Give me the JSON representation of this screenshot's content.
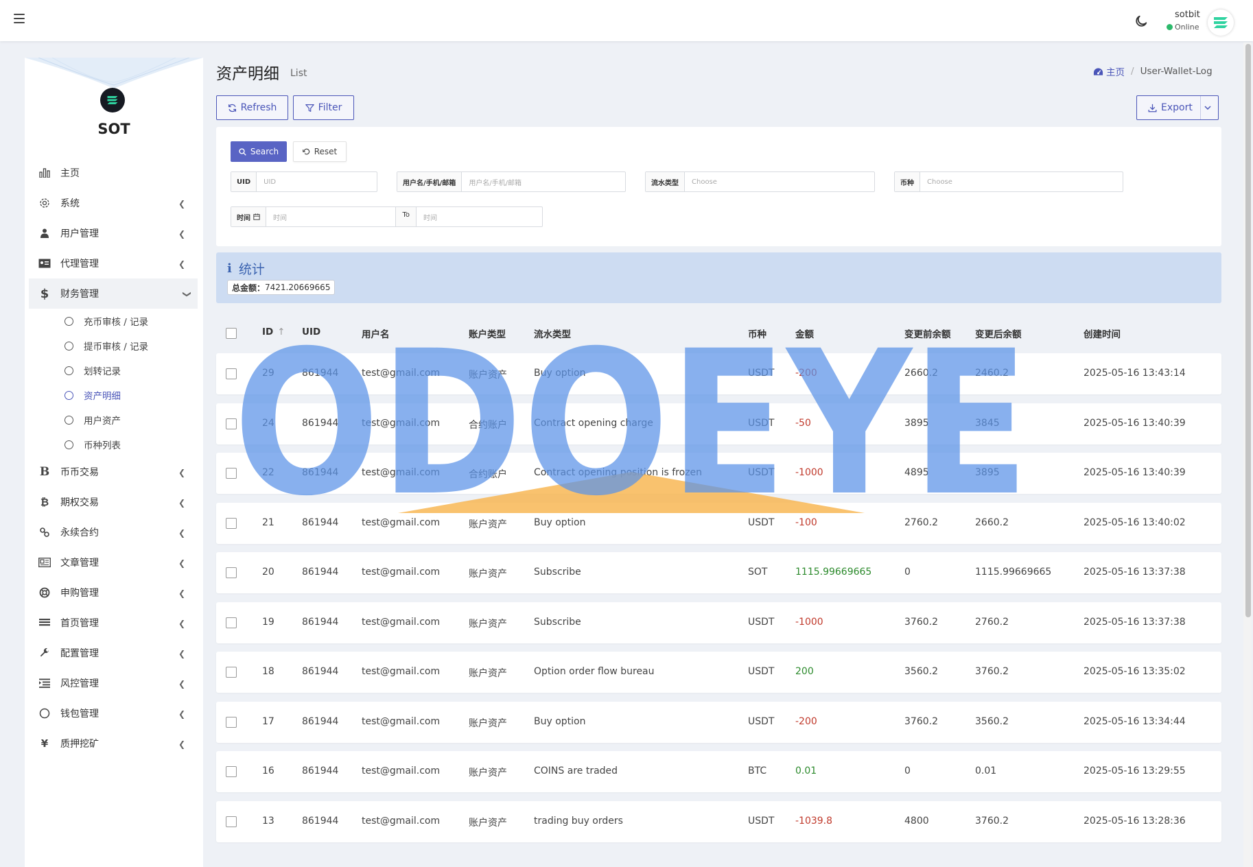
{
  "header": {
    "user_name": "sotbit",
    "user_status": "Online"
  },
  "sidebar": {
    "brand": "SOT",
    "items": [
      {
        "label": "主页",
        "icon": "bar-chart-icon",
        "has_children": false
      },
      {
        "label": "系统",
        "icon": "gear-icon",
        "has_children": true
      },
      {
        "label": "用户管理",
        "icon": "users-icon",
        "has_children": true
      },
      {
        "label": "代理管理",
        "icon": "id-card-icon",
        "has_children": true
      },
      {
        "label": "财务管理",
        "icon": "dollar-icon",
        "has_children": true,
        "open": true,
        "children": [
          {
            "label": "充币审核 / 记录"
          },
          {
            "label": "提币审核 / 记录"
          },
          {
            "label": "划转记录"
          },
          {
            "label": "资产明细",
            "active": true
          },
          {
            "label": "用户资产"
          },
          {
            "label": "币种列表"
          }
        ]
      },
      {
        "label": "币币交易",
        "icon": "b-icon",
        "has_children": true
      },
      {
        "label": "期权交易",
        "icon": "bitcoin-icon",
        "has_children": true
      },
      {
        "label": "永续合约",
        "icon": "link-icon",
        "has_children": true
      },
      {
        "label": "文章管理",
        "icon": "newspaper-icon",
        "has_children": true
      },
      {
        "label": "申购管理",
        "icon": "lifebuoy-icon",
        "has_children": true
      },
      {
        "label": "首页管理",
        "icon": "list-icon",
        "has_children": true
      },
      {
        "label": "配置管理",
        "icon": "wrench-icon",
        "has_children": true
      },
      {
        "label": "风控管理",
        "icon": "indent-icon",
        "has_children": true
      },
      {
        "label": "钱包管理",
        "icon": "circle-icon",
        "has_children": true
      },
      {
        "label": "质押挖矿",
        "icon": "yen-icon",
        "has_children": true
      }
    ]
  },
  "page": {
    "title": "资产明细",
    "subtitle": "List",
    "breadcrumb_home": "主页",
    "breadcrumb_current": "User-Wallet-Log"
  },
  "toolbar": {
    "refresh": "Refresh",
    "filter": "Filter",
    "export": "Export"
  },
  "filter": {
    "search": "Search",
    "reset": "Reset",
    "uid_label": "UID",
    "uid_placeholder": "UID",
    "user_label": "用户名/手机/邮箱",
    "user_placeholder": "用户名/手机/邮箱",
    "flow_label": "流水类型",
    "flow_placeholder": "Choose",
    "coin_label": "币种",
    "coin_placeholder": "Choose",
    "time_label": "时间",
    "time_placeholder": "时间",
    "to_label": "To",
    "time_end_placeholder": "时间"
  },
  "stats": {
    "title": "统计",
    "total_label": "总金额：",
    "total_value": "7421.20669665"
  },
  "table": {
    "headers": [
      "ID",
      "UID",
      "用户名",
      "账户类型",
      "流水类型",
      "币种",
      "金额",
      "变更前余额",
      "变更后余额",
      "创建时间"
    ],
    "rows": [
      {
        "id": "29",
        "uid": "861944",
        "user": "test@gmail.com",
        "account": "账户资产",
        "flow": "Buy option",
        "coin": "USDT",
        "amount": "-200",
        "sign": "neg",
        "before": "2660.2",
        "after": "2460.2",
        "time": "2025-05-16 13:43:14"
      },
      {
        "id": "24",
        "uid": "861944",
        "user": "test@gmail.com",
        "account": "合约账户",
        "flow": "Contract opening charge",
        "coin": "USDT",
        "amount": "-50",
        "sign": "neg",
        "before": "3895",
        "after": "3845",
        "time": "2025-05-16 13:40:39"
      },
      {
        "id": "22",
        "uid": "861944",
        "user": "test@gmail.com",
        "account": "合约账户",
        "flow": "Contract opening position is frozen",
        "coin": "USDT",
        "amount": "-1000",
        "sign": "neg",
        "before": "4895",
        "after": "3895",
        "time": "2025-05-16 13:40:39"
      },
      {
        "id": "21",
        "uid": "861944",
        "user": "test@gmail.com",
        "account": "账户资产",
        "flow": "Buy option",
        "coin": "USDT",
        "amount": "-100",
        "sign": "neg",
        "before": "2760.2",
        "after": "2660.2",
        "time": "2025-05-16 13:40:02"
      },
      {
        "id": "20",
        "uid": "861944",
        "user": "test@gmail.com",
        "account": "账户资产",
        "flow": "Subscribe",
        "coin": "SOT",
        "amount": "1115.99669665",
        "sign": "pos",
        "before": "0",
        "after": "1115.99669665",
        "time": "2025-05-16 13:37:38"
      },
      {
        "id": "19",
        "uid": "861944",
        "user": "test@gmail.com",
        "account": "账户资产",
        "flow": "Subscribe",
        "coin": "USDT",
        "amount": "-1000",
        "sign": "neg",
        "before": "3760.2",
        "after": "2760.2",
        "time": "2025-05-16 13:37:38"
      },
      {
        "id": "18",
        "uid": "861944",
        "user": "test@gmail.com",
        "account": "账户资产",
        "flow": "Option order flow bureau",
        "coin": "USDT",
        "amount": "200",
        "sign": "pos",
        "before": "3560.2",
        "after": "3760.2",
        "time": "2025-05-16 13:35:02"
      },
      {
        "id": "17",
        "uid": "861944",
        "user": "test@gmail.com",
        "account": "账户资产",
        "flow": "Buy option",
        "coin": "USDT",
        "amount": "-200",
        "sign": "neg",
        "before": "3760.2",
        "after": "3560.2",
        "time": "2025-05-16 13:34:44"
      },
      {
        "id": "16",
        "uid": "861944",
        "user": "test@gmail.com",
        "account": "账户资产",
        "flow": "COINS are traded",
        "coin": "BTC",
        "amount": "0.01",
        "sign": "pos",
        "before": "0",
        "after": "0.01",
        "time": "2025-05-16 13:29:55"
      },
      {
        "id": "13",
        "uid": "861944",
        "user": "test@gmail.com",
        "account": "账户资产",
        "flow": "trading buy orders",
        "coin": "USDT",
        "amount": "-1039.8",
        "sign": "neg",
        "before": "4800",
        "after": "3760.2",
        "time": "2025-05-16 13:28:36"
      }
    ]
  },
  "watermark": {
    "text": "ODOEYE",
    "color": "#5b93e8",
    "accent": "#f7b34a"
  },
  "colors": {
    "primary": "#4a55b8",
    "negative": "#c0392b",
    "positive": "#2c8a2c",
    "online": "#2cb96b",
    "stats_bg": "#cddcf2"
  }
}
